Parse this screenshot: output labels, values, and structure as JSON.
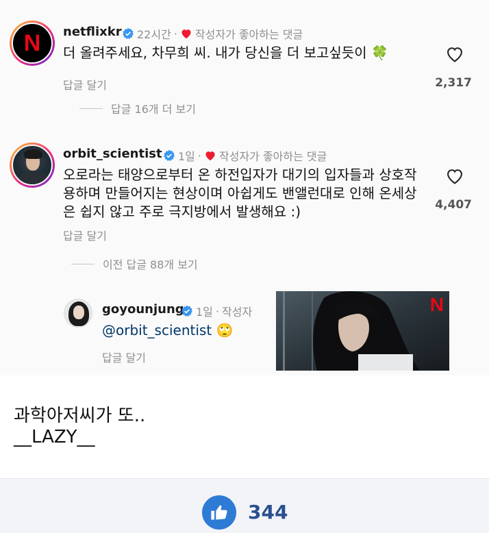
{
  "comments": [
    {
      "username": "netflixkr",
      "time": "22시간",
      "sep": "·",
      "creator_liked": "작성자가 좋아하는 댓글",
      "text": "더 올려주세요, 차무희 씨. 내가 당신을 더 보고싶듯이",
      "reply_label": "답글 달기",
      "likes": "2,317",
      "view_replies": "답글 16개 더 보기",
      "avatar_letter": "N"
    },
    {
      "username": "orbit_scientist",
      "time": "1일",
      "sep": "·",
      "creator_liked": "작성자가 좋아하는 댓글",
      "text_lines": [
        "오로라는 태양으로부터 온 하전입자가 대기의 입자들과 상호작",
        "용하며 만들어지는 현상이며 아쉽게도 밴앨런대로 인해 온세상",
        "은 쉽지 않고 주로 극지방에서 발생해요 :)"
      ],
      "reply_label": "답글 달기",
      "likes": "4,407",
      "view_replies": "이전 답글 88개 보기"
    }
  ],
  "reply": {
    "username": "goyounjung",
    "time": "1일",
    "sep": "·",
    "author_badge": "작성자",
    "mention": "@orbit_scientist",
    "emoji": "🙄",
    "reply_label": "답글 달기",
    "image_brand": "N"
  },
  "clover": "🍀",
  "caption": {
    "line1": "과학아저씨가 또..",
    "line2": "__LAZY__"
  },
  "footer": {
    "like_total": "344"
  },
  "colors": {
    "heart_red": "#ed1c33",
    "verified_blue": "#3897f0",
    "netflix_red": "#e50914",
    "like_blue": "#2e7bd6"
  }
}
